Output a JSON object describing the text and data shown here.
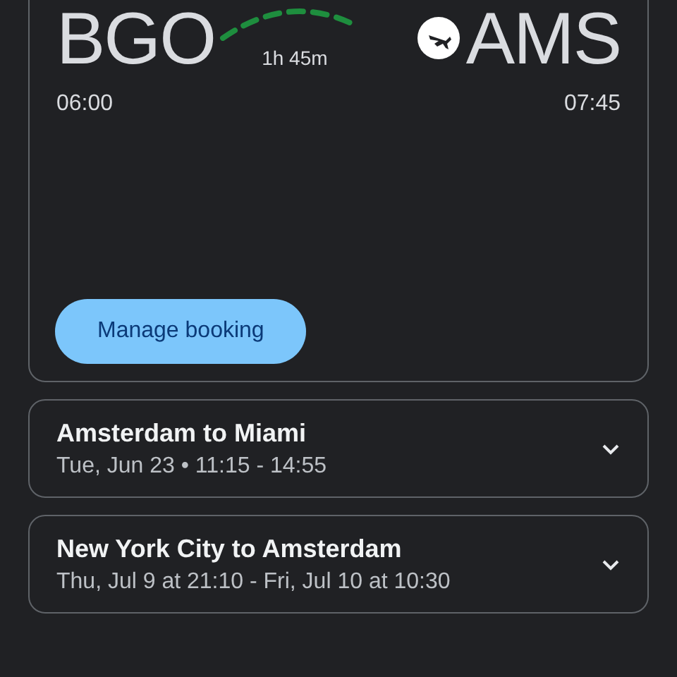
{
  "flight": {
    "origin": "BGO",
    "destination": "AMS",
    "duration": "1h 45m",
    "departure_time": "06:00",
    "arrival_time": "07:45",
    "button": "Manage booking"
  },
  "trips": [
    {
      "title": "Amsterdam to Miami",
      "details": "Tue, Jun 23 • 11:15 - 14:55",
      "expanded": false
    },
    {
      "title": "New York City to Amsterdam",
      "details": "Thu, Jul 9 at 21:10 - Fri, Jul 10 at 10:30",
      "expanded": false
    }
  ]
}
